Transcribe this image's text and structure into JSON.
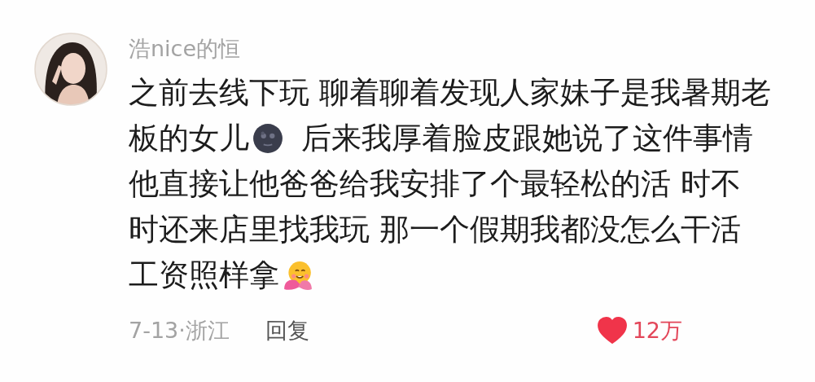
{
  "comment": {
    "author": "浩nice的恒",
    "lines": [
      [
        {
          "kind": "text",
          "text": "之前去线下玩 聊着聊着发现人家妹子是我暑期老"
        }
      ],
      [
        {
          "kind": "text",
          "text": "板的女儿"
        },
        {
          "kind": "moon"
        },
        {
          "kind": "text",
          "text": "后来我厚着脸皮跟她说了这件事情"
        }
      ],
      [
        {
          "kind": "text",
          "text": "他直接让他爸爸给我安排了个最轻松的活 时不"
        }
      ],
      [
        {
          "kind": "text",
          "text": "时还来店里找我玩 那一个假期我都没怎么干活"
        }
      ],
      [
        {
          "kind": "text",
          "text": "工资照样拿"
        },
        {
          "kind": "hug"
        }
      ]
    ],
    "meta": "7-13·浙江",
    "reply": "回复",
    "like": {
      "count": "12万",
      "liked": true
    }
  }
}
